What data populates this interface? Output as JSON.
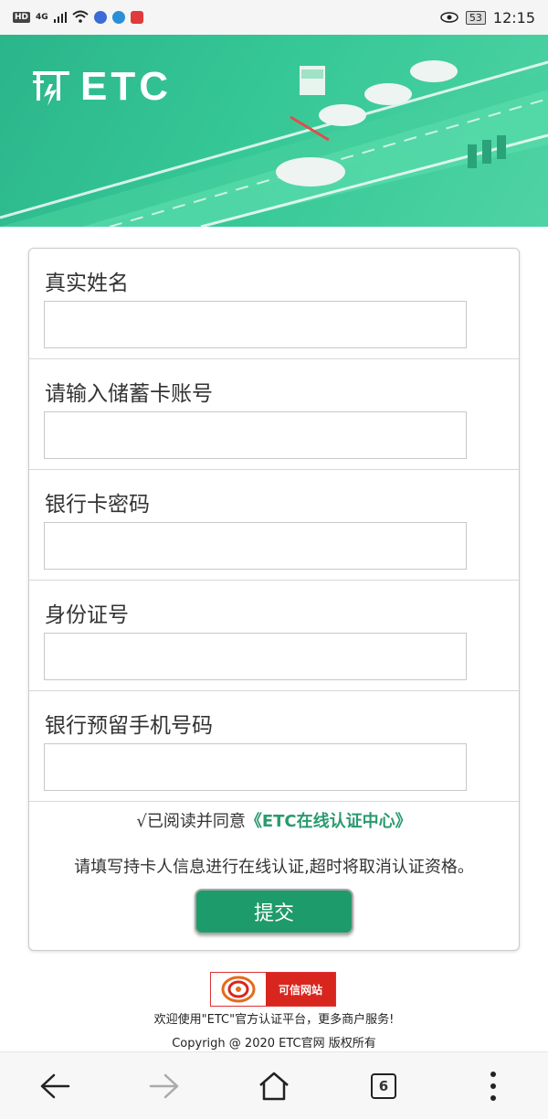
{
  "status_bar": {
    "hd": "HD",
    "network": "4G",
    "battery": "53",
    "time": "12:15"
  },
  "banner": {
    "logo_text": "ETC"
  },
  "form": {
    "fields": [
      {
        "label": "真实姓名",
        "value": ""
      },
      {
        "label": "请输入储蓄卡账号",
        "value": ""
      },
      {
        "label": "银行卡密码",
        "value": ""
      },
      {
        "label": "身份证号",
        "value": ""
      },
      {
        "label": "银行预留手机号码",
        "value": ""
      }
    ],
    "agree_prefix": "√已阅读并同意",
    "agree_link": "《ETC在线认证中心》",
    "notice": "请填写持卡人信息进行在线认证,超时将取消认证资格。",
    "submit_label": "提交"
  },
  "footer": {
    "trust_badge": "可信网站",
    "welcome": "欢迎使用\"ETC\"官方认证平台，更多商户服务!",
    "copyright": "Copyrigh @ 2020 ETC官网 版权所有"
  },
  "nav": {
    "tab_count": "6"
  },
  "colors": {
    "brand_green": "#1e9b6a",
    "link_green": "#2a9a6f",
    "banner_green": "#35c796"
  }
}
